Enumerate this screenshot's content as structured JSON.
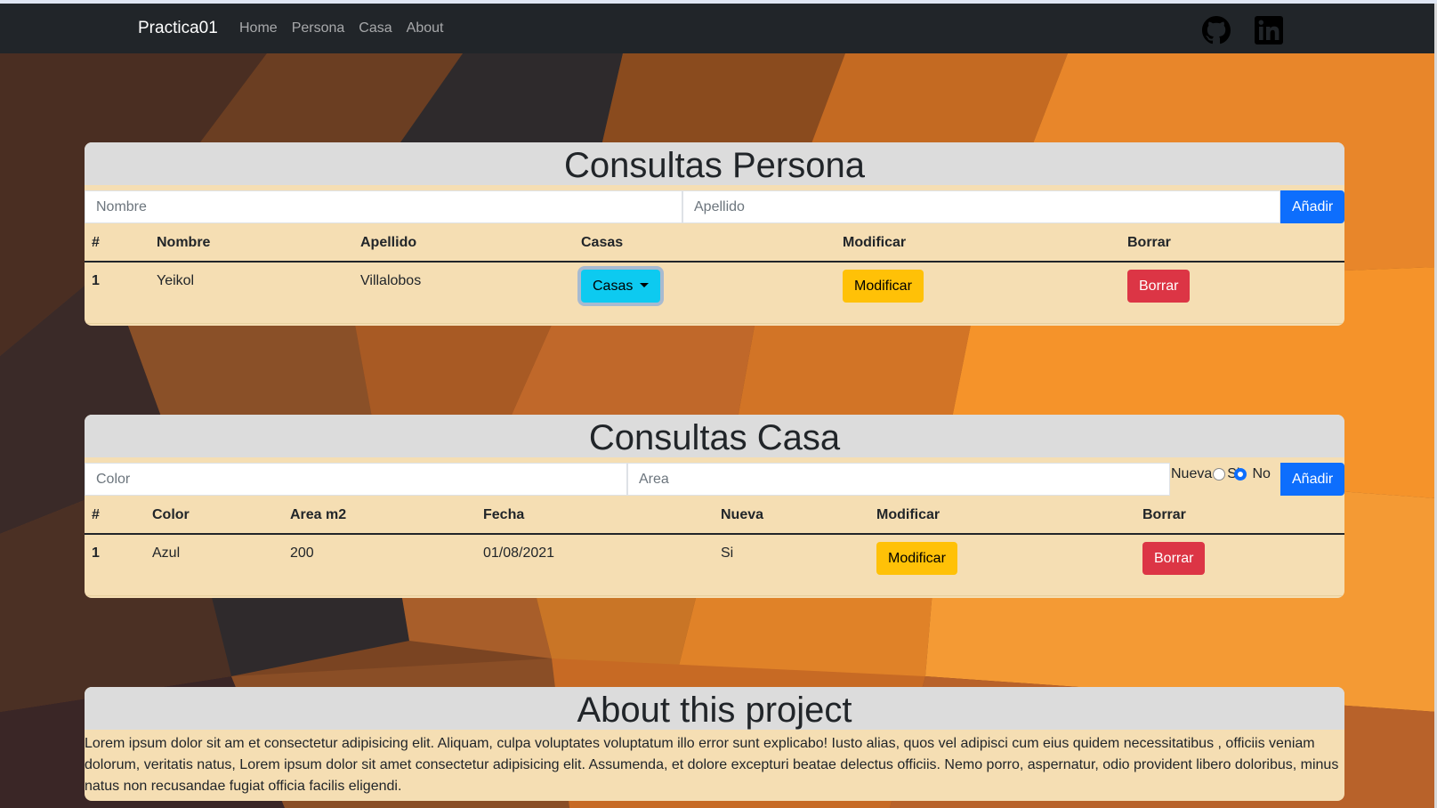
{
  "navbar": {
    "brand": "Practica01",
    "links": [
      "Home",
      "Persona",
      "Casa",
      "About"
    ],
    "icons": [
      "github-icon",
      "linkedin-icon"
    ]
  },
  "persona": {
    "title": "Consultas Persona",
    "inputs": {
      "nombre_placeholder": "Nombre",
      "apellido_placeholder": "Apellido"
    },
    "add_label": "Añadir",
    "columns": [
      "#",
      "Nombre",
      "Apellido",
      "Casas",
      "Modificar",
      "Borrar"
    ],
    "rows": [
      {
        "id": "1",
        "nombre": "Yeikol",
        "apellido": "Villalobos",
        "casas_label": "Casas",
        "modificar_label": "Modificar",
        "borrar_label": "Borrar"
      }
    ]
  },
  "casa": {
    "title": "Consultas Casa",
    "inputs": {
      "color_placeholder": "Color",
      "area_placeholder": "Area"
    },
    "radio": {
      "label": "Nueva",
      "options": [
        "Si",
        "No"
      ],
      "selected": "Si"
    },
    "add_label": "Añadir",
    "columns": [
      "#",
      "Color",
      "Area m2",
      "Fecha",
      "Nueva",
      "Modificar",
      "Borrar"
    ],
    "rows": [
      {
        "id": "1",
        "color": "Azul",
        "area": "200",
        "fecha": "01/08/2021",
        "nueva": "Si",
        "modificar_label": "Modificar",
        "borrar_label": "Borrar"
      }
    ]
  },
  "about": {
    "title": "About this project",
    "body": "Lorem ipsum dolor sit am et consectetur adipisicing elit. Aliquam, culpa voluptates voluptatum illo error sunt explicabo! Iusto alias, quos vel adipisci cum eius quidem necessitatibus , officiis veniam dolorum, veritatis natus, Lorem ipsum dolor sit amet consectetur adipisicing elit. Assumenda, et dolore excepturi beatae delectus officiis. Nemo porro, aspernatur, odio provident libero doloribus, minus natus non recusandae fugiat officia facilis eligendi."
  },
  "colors": {
    "primary": "#0d6efd",
    "warning": "#ffc107",
    "danger": "#dc3545",
    "info": "#0dcaf0",
    "card": "#f5deb3",
    "navbar": "#212529"
  }
}
